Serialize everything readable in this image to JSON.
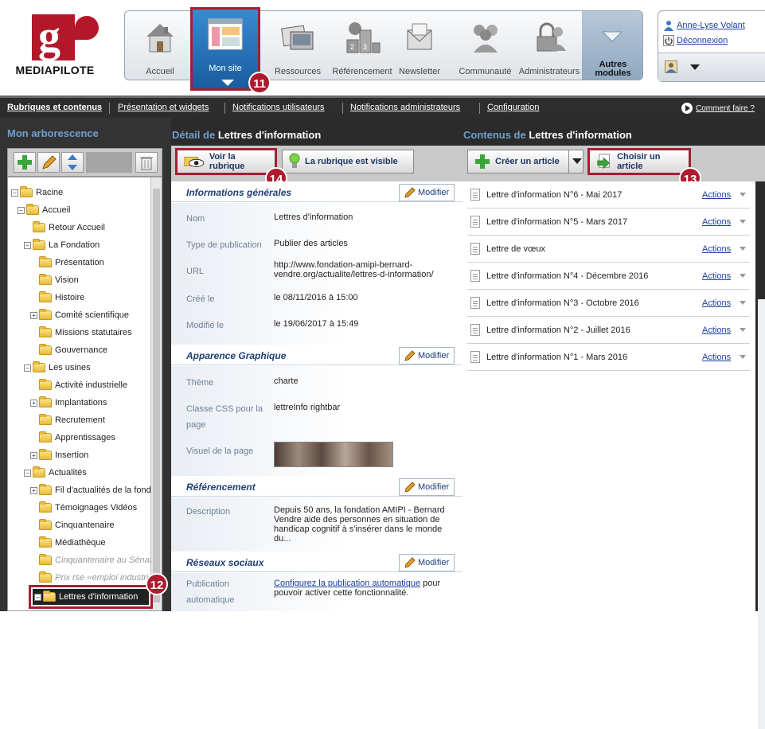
{
  "brand": {
    "name": "MEDIAPILOTE",
    "letter": "g"
  },
  "modules": [
    {
      "id": "accueil",
      "label": "Accueil"
    },
    {
      "id": "mon-site",
      "label": "Mon site"
    },
    {
      "id": "ressources",
      "label": "Ressources"
    },
    {
      "id": "referencement",
      "label": "Référencement"
    },
    {
      "id": "newsletter",
      "label": "Newsletter"
    },
    {
      "id": "communaute",
      "label": "Communauté"
    },
    {
      "id": "administrateurs",
      "label": "Administrateurs"
    },
    {
      "id": "autres",
      "label": "Autres modules"
    }
  ],
  "user": {
    "name": "Anne-Lyse Volant",
    "logout": "Déconnexion"
  },
  "nav": {
    "tabs": [
      "Rubriques et contenus",
      "Présentation et widgets",
      "Notifications utilisateurs",
      "Notifications administrateurs",
      "Configuration"
    ],
    "help": "Comment faire ?"
  },
  "badges": {
    "b11": "11",
    "b12": "12",
    "b13": "13",
    "b14": "14"
  },
  "tree": {
    "title": "Mon arborescence",
    "nodes": [
      {
        "label": "Racine",
        "toggle": "−"
      },
      {
        "label": "Accueil",
        "toggle": "−"
      },
      {
        "label": "Retour Accueil",
        "toggle": ""
      },
      {
        "label": "La Fondation",
        "toggle": "−"
      },
      {
        "label": "Présentation",
        "toggle": ""
      },
      {
        "label": "Vision",
        "toggle": ""
      },
      {
        "label": "Histoire",
        "toggle": ""
      },
      {
        "label": "Comité scientifique",
        "toggle": "+"
      },
      {
        "label": "Missions statutaires",
        "toggle": ""
      },
      {
        "label": "Gouvernance",
        "toggle": ""
      },
      {
        "label": "Les usines",
        "toggle": "−"
      },
      {
        "label": "Activité industrielle",
        "toggle": ""
      },
      {
        "label": "Implantations",
        "toggle": "+"
      },
      {
        "label": "Recrutement",
        "toggle": ""
      },
      {
        "label": "Apprentissages",
        "toggle": ""
      },
      {
        "label": "Insertion",
        "toggle": "+"
      },
      {
        "label": "Actualités",
        "toggle": "−"
      },
      {
        "label": "Fil d'actualités de la fond",
        "toggle": "+"
      },
      {
        "label": "Témoignages Vidéos",
        "toggle": ""
      },
      {
        "label": "Cinquantenaire",
        "toggle": ""
      },
      {
        "label": "Médiathèque",
        "toggle": ""
      },
      {
        "label": "Cinquantenaire au Sénat",
        "toggle": ""
      },
      {
        "label": "Prix rse «emploi industriel",
        "toggle": ""
      }
    ],
    "selected": "Lettres d'information"
  },
  "detail": {
    "pre": "Détail de",
    "title": "Lettres d'information",
    "view_btn": "Voir la rubrique",
    "visible_btn": "La rubrique est visible",
    "modify": "Modifier",
    "general": {
      "title": "Informations générales",
      "fields": [
        {
          "label": "Nom",
          "value": "Lettres d'information"
        },
        {
          "label": "Type de publication",
          "value": "Publier des articles"
        },
        {
          "label": "URL",
          "value": "http://www.fondation-amipi-bernard-vendre.org/actualite/lettres-d-information/"
        },
        {
          "label": "Créé le",
          "value": "le 08/11/2016 à 15:00"
        },
        {
          "label": "Modifié le",
          "value": "le 19/06/2017 à 15:49"
        }
      ]
    },
    "graphic": {
      "title": "Apparence Graphique",
      "fields": [
        {
          "label": "Thème",
          "value": "charte"
        },
        {
          "label": "Classe CSS pour la page",
          "value": "lettreInfo rightbar"
        },
        {
          "label": "Visuel de la page",
          "value": ""
        }
      ]
    },
    "seo": {
      "title": "Référencement",
      "fields": [
        {
          "label": "Description",
          "value": "Depuis 50 ans, la fondation AMIPI - Bernard Vendre aide des personnes en situation de handicap cognitif à s'insérer dans le monde du..."
        }
      ]
    },
    "social": {
      "title": "Réseaux sociaux",
      "label": "Publication automatique",
      "link": "Configurez la publication automatique",
      "rest": " pour pouvoir activer cette fonctionnalité."
    }
  },
  "contents": {
    "pre": "Contenus de",
    "title": "Lettres d'information",
    "create_btn": "Créer un article",
    "choose_btn": "Choisir un article",
    "actions": "Actions",
    "articles": [
      "Lettre d'information N°6 - Mai 2017",
      "Lettre d'information N°5 - Mars 2017",
      "Lettre de vœux",
      "Lettre d'information N°4 - Décembre 2016",
      "Lettre d'information N°3 - Octobre 2016",
      "Lettre d'information N°2 - Juillet 2016",
      "Lettre d'information N°1 - Mars 2016"
    ]
  }
}
